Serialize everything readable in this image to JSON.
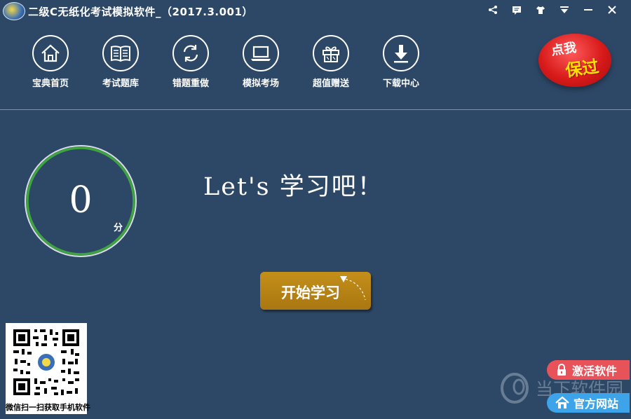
{
  "window": {
    "title": "二级C无纸化考试模拟软件_（2017.3.001）"
  },
  "toolbar": {
    "items": [
      {
        "label": "宝典首页",
        "icon": "home-icon"
      },
      {
        "label": "考试题库",
        "icon": "book-icon"
      },
      {
        "label": "错题重做",
        "icon": "refresh-icon"
      },
      {
        "label": "模拟考场",
        "icon": "laptop-icon"
      },
      {
        "label": "超值赠送",
        "icon": "gift-icon"
      },
      {
        "label": "下载中心",
        "icon": "download-icon"
      }
    ]
  },
  "badge": {
    "line1": "点我",
    "line2": "保过"
  },
  "score": {
    "value": "0",
    "unit": "分"
  },
  "headline": "Let's 学习吧！",
  "start_button": "开始学习",
  "qr": {
    "caption": "微信扫一扫获取手机软件"
  },
  "side_buttons": {
    "activate": "激活软件",
    "website": "官方网站"
  },
  "watermark": "当下软件园",
  "colors": {
    "background": "#2d4867",
    "ring": "#3fa33f",
    "start": "#b8841a",
    "activate": "#e8535a",
    "website": "#3da4ea",
    "badge_red": "#d81a1a"
  }
}
